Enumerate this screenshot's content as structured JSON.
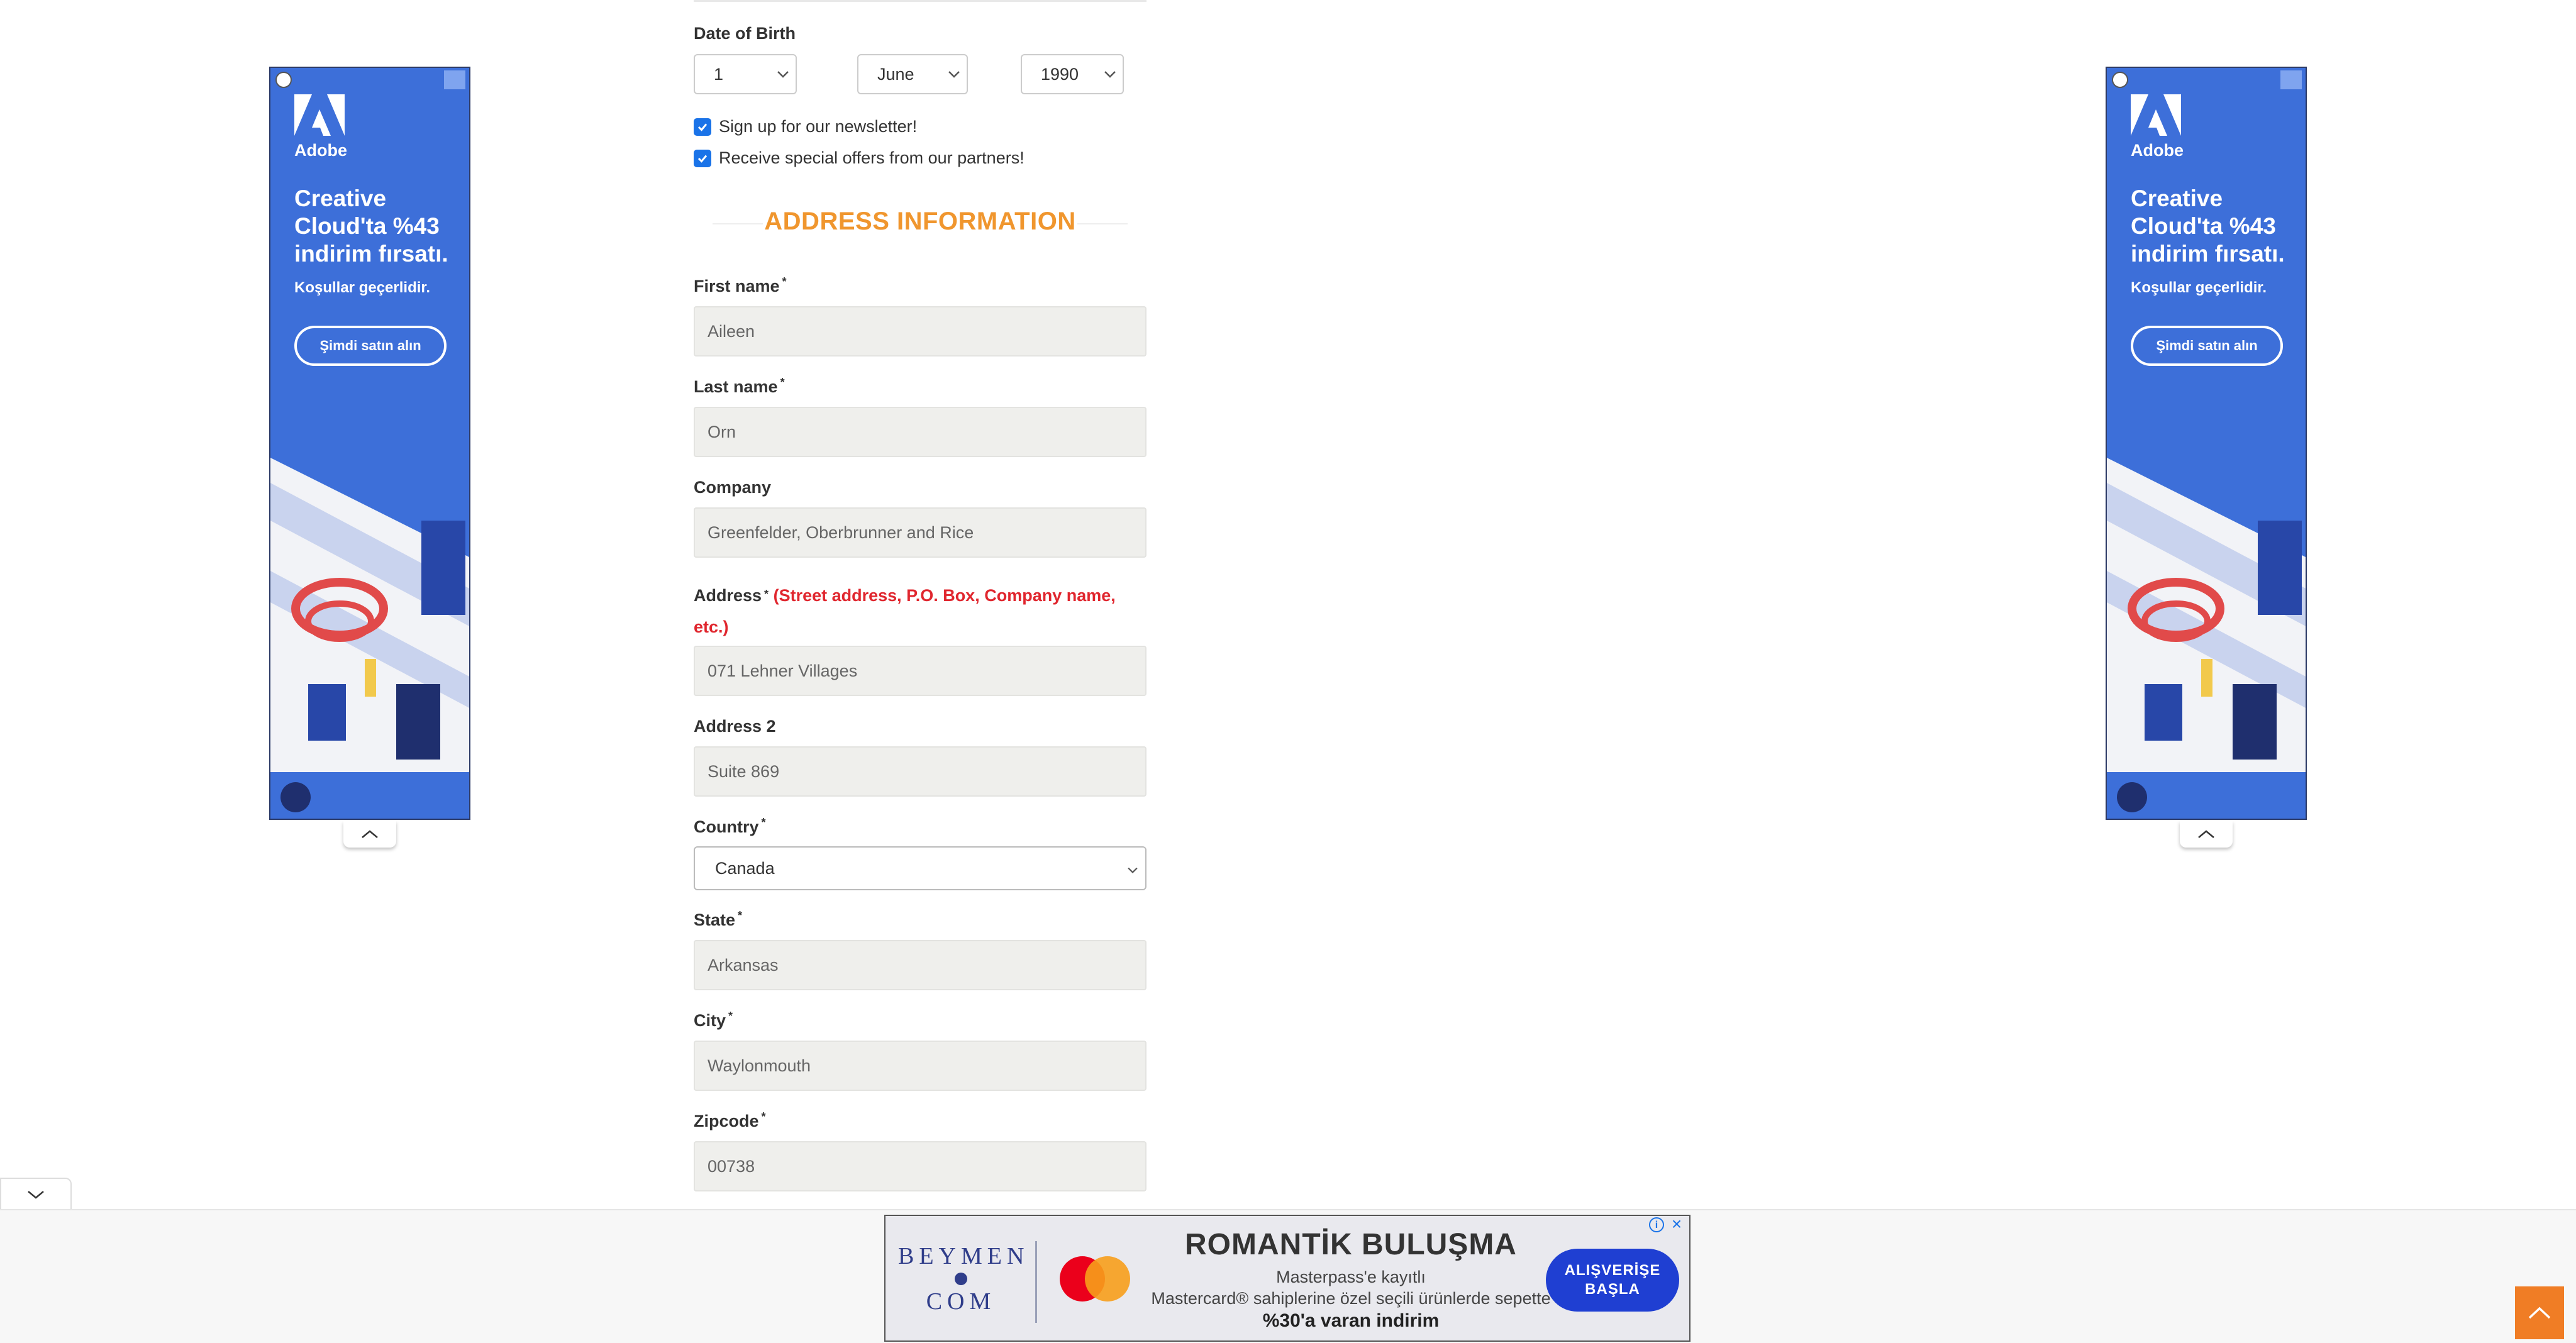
{
  "form": {
    "dob": {
      "label": "Date of Birth",
      "day": "1",
      "month": "June",
      "year": "1990"
    },
    "newsletter": {
      "label": "Sign up for our newsletter!",
      "checked": true
    },
    "partners": {
      "label": "Receive special offers from our partners!",
      "checked": true
    },
    "section_title": "ADDRESS INFORMATION",
    "required_mark": "*",
    "first_name": {
      "label": "First name",
      "value": "Aileen"
    },
    "last_name": {
      "label": "Last name",
      "value": "Orn"
    },
    "company": {
      "label": "Company",
      "value": "Greenfelder, Oberbrunner and Rice"
    },
    "address": {
      "label": "Address",
      "hint": "(Street address, P.O. Box, Company name, etc.)",
      "value": "071 Lehner Villages"
    },
    "address2": {
      "label": "Address 2",
      "value": "Suite 869"
    },
    "country": {
      "label": "Country",
      "value": "Canada"
    },
    "state": {
      "label": "State",
      "value": "Arkansas"
    },
    "city": {
      "label": "City",
      "value": "Waylonmouth"
    },
    "zipcode": {
      "label": "Zipcode",
      "value": "00738"
    }
  },
  "side_ad": {
    "brand": "Adobe",
    "headline": "Creative Cloud'ta %43 indirim fırsatı.",
    "sub": "Koşullar geçerlidir.",
    "cta": "Şimdi satın alın",
    "color": "#3d6fd9"
  },
  "bottom_banner": {
    "brand_top": "BEYMEN",
    "brand_bottom": "COM",
    "headline": "ROMANTİK BULUŞMA",
    "line1": "Masterpass'e kayıtlı",
    "line2": "Mastercard® sahiplerine özel seçili ürünlerde sepette",
    "line3": "%30'a varan indirim",
    "cta": "ALIŞVERİŞE BAŞLA",
    "info": "i",
    "close": "×"
  },
  "icons": {
    "chevron_down": "chevron-down-icon",
    "chevron_up": "chevron-up-icon",
    "check": "check-icon",
    "scroll_top": "arrow-up-icon"
  },
  "colors": {
    "accent_orange": "#f0962e",
    "required_red": "#e0262e",
    "checkbox_blue": "#1a73e8",
    "scroll_button": "#f07d25"
  }
}
